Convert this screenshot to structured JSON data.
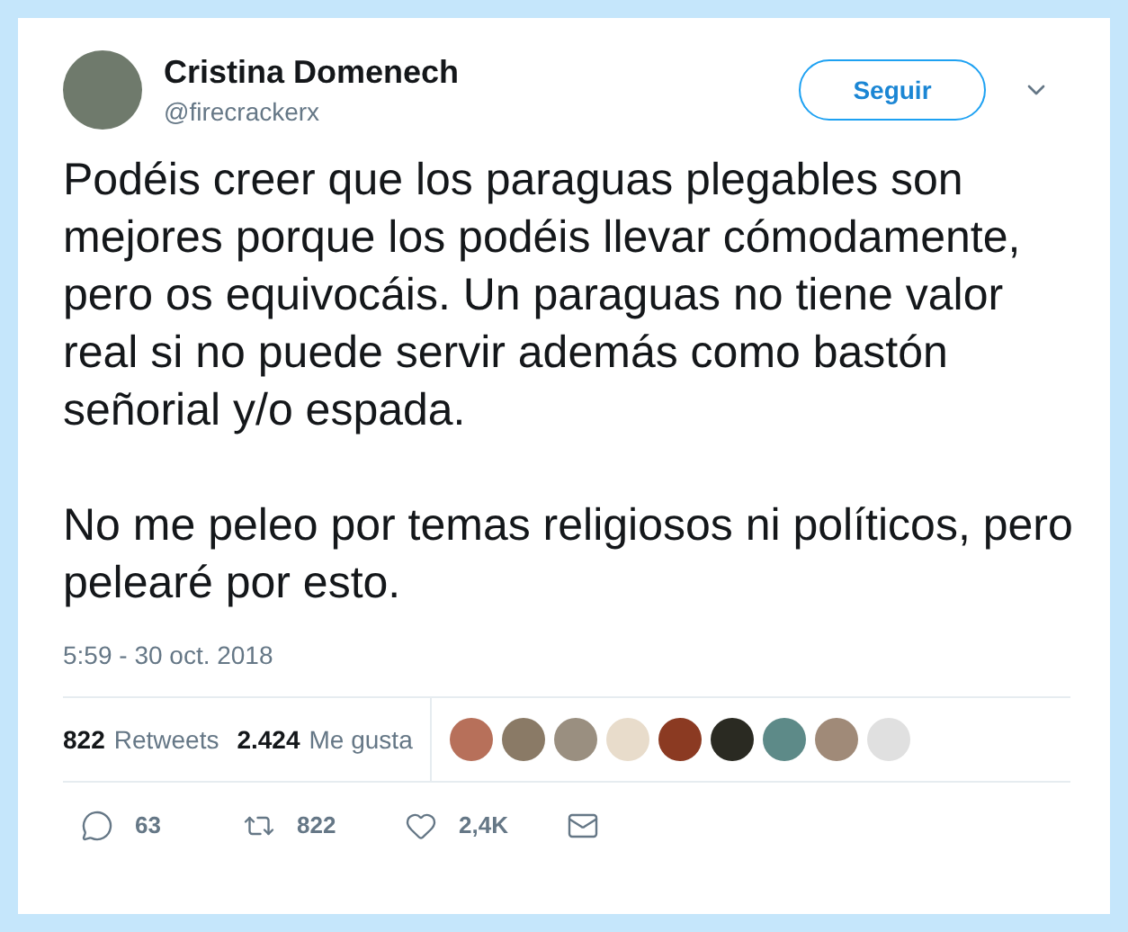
{
  "author": {
    "name": "Cristina Domenech",
    "handle": "@firecrackerx"
  },
  "follow_button": "Seguir",
  "paragraphs": [
    "Podéis creer que los paraguas plegables son mejores porque los podéis llevar cómodamente, pero os equivocáis. Un paraguas no tiene valor real si no puede servir además como bastón señorial y/o espada.",
    "No me peleo por temas religiosos ni políticos, pero pelearé por esto."
  ],
  "timestamp": "5:59 - 30 oct. 2018",
  "stats": [
    {
      "count": "822",
      "label": "Retweets"
    },
    {
      "count": "2.424",
      "label": "Me gusta"
    }
  ],
  "actions": [
    {
      "kind": "reply",
      "count": "63"
    },
    {
      "kind": "retweet",
      "count": "822"
    },
    {
      "kind": "like",
      "count": "2,4K"
    },
    {
      "kind": "message"
    }
  ]
}
